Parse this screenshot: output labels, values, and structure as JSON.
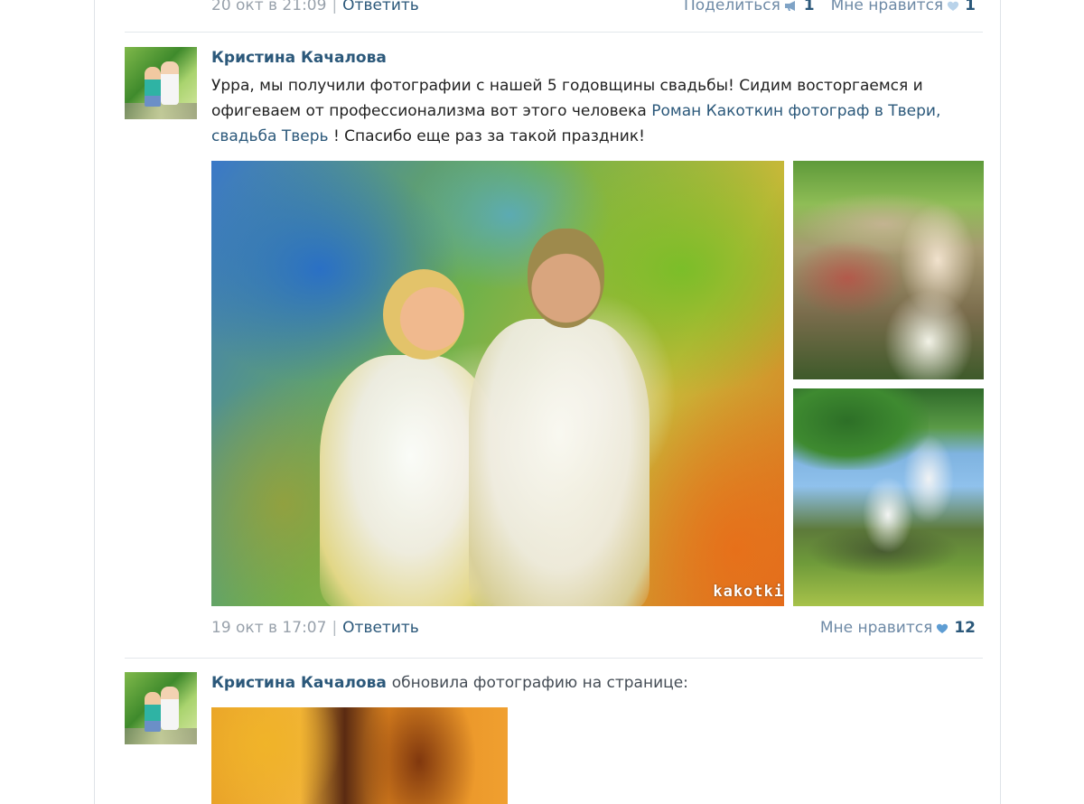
{
  "previous_post": {
    "date": "20 окт в 21:09",
    "separator": "|",
    "reply_label": "Ответить",
    "share_label": "Поделиться",
    "share_count": "1",
    "like_label": "Мне нравится",
    "like_count": "1"
  },
  "post": {
    "author": "Кристина Качалова",
    "text_before": "Урра, мы получили фотографии с нашей 5 годовщины свадьбы! Сидим восторгаемся и офигеваем от профессионализма вот этого человека ",
    "link_text": "Роман Какоткин фотограф в Твери, свадьба Тверь",
    "text_after": " ! Спасибо еще раз за такой праздник!",
    "photo_watermark": "kakotki",
    "date": "19 окт в 17:07",
    "separator": "|",
    "reply_label": "Ответить",
    "like_label": "Мне нравится",
    "like_count": "12"
  },
  "next_post": {
    "author": "Кристина Качалова",
    "action": "обновила фотографию на странице:"
  },
  "colors": {
    "link": "#2b587a",
    "like_heart": "#5e9dd3",
    "share_icon": "#7fa3c6",
    "divider": "#e3e7eb"
  },
  "icons": {
    "share": "megaphone-icon",
    "like": "heart-icon"
  }
}
